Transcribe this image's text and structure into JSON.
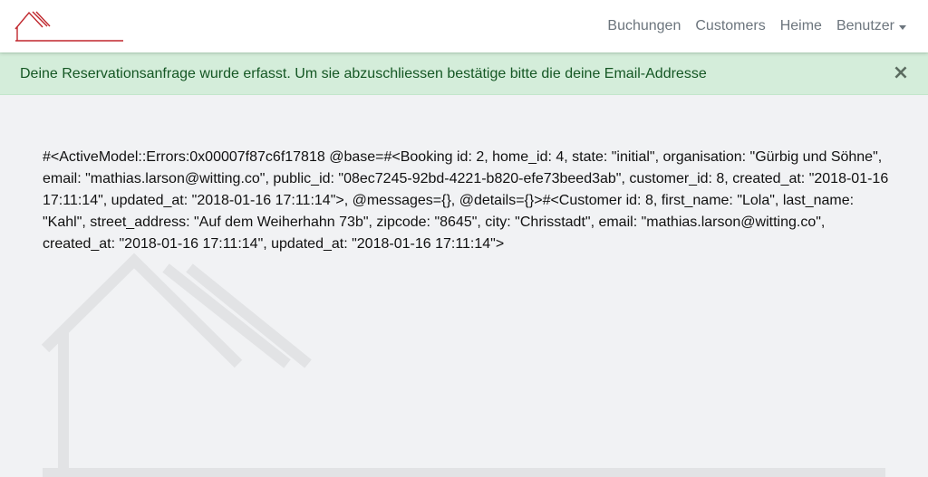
{
  "nav": {
    "logo": "home-roof-logo",
    "links": [
      "Buchungen",
      "Customers",
      "Heime"
    ],
    "user_menu_label": "Benutzer"
  },
  "alert": {
    "message": "Deine Reservationsanfrage wurde erfasst. Um sie abzuschliessen bestätige bitte die deine Email-Addresse",
    "close_label": "×"
  },
  "main": {
    "debug_output": "#<ActiveModel::Errors:0x00007f87c6f17818 @base=#<Booking id: 2, home_id: 4, state: \"initial\", organisation: \"Gürbig und Söhne\", email: \"mathias.larson@witting.co\", public_id: \"08ec7245-92bd-4221-b820-efe73beed3ab\", customer_id: 8, created_at: \"2018-01-16 17:11:14\", updated_at: \"2018-01-16 17:11:14\">, @messages={}, @details={}>#<Customer id: 8, first_name: \"Lola\", last_name: \"Kahl\", street_address: \"Auf dem Weiherhahn 73b\", zipcode: \"8645\", city: \"Chrisstadt\", email: \"mathias.larson@witting.co\", created_at: \"2018-01-16 17:11:14\", updated_at: \"2018-01-16 17:11:14\">"
  },
  "colors": {
    "brand_red": "#c0272d",
    "alert_bg": "#d4edda",
    "alert_text": "#155724",
    "nav_text": "#6c757d",
    "watermark": "#e2e3e5"
  }
}
